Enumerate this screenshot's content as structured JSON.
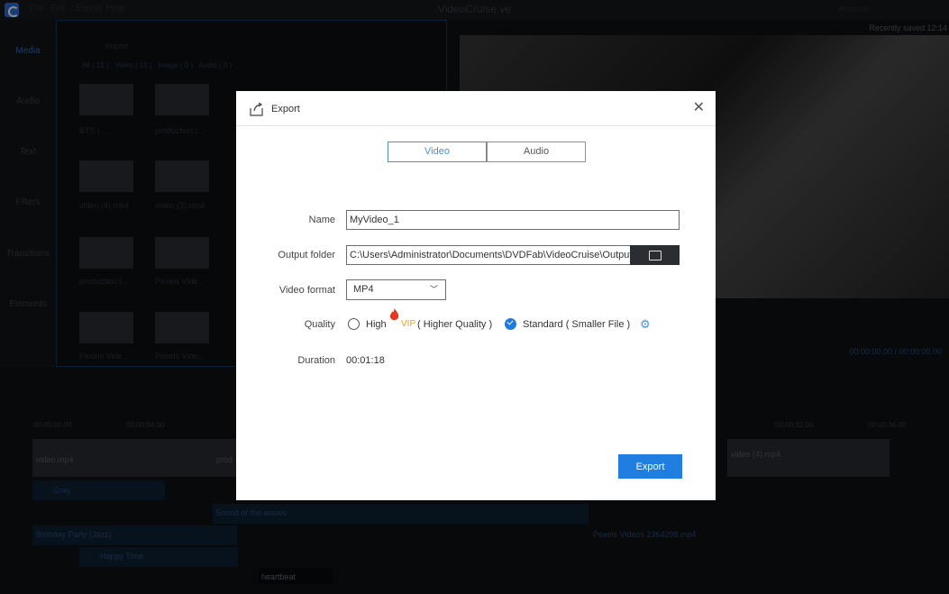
{
  "app": {
    "title": "VideoCruise.ve",
    "menus": [
      "File",
      "Edit",
      "Export",
      "Help"
    ],
    "account": "Account",
    "recently_saved": "Recently saved 12:14"
  },
  "sidebar": {
    "tabs": [
      "Media",
      "Audio",
      "Text",
      "Filters",
      "Transitions",
      "Elements"
    ]
  },
  "media": {
    "import_label": "Import",
    "filters": "All ( 15 )   Video ( 15 )   Image ( 0 )   Audio ( 0 )",
    "items": [
      "BTS ( ...",
      "production l...",
      "video (4).mp4",
      "video (3).mp4",
      "production l...",
      "Pexels Vide...",
      "Pexels Vide...",
      "Pexels Vide..."
    ]
  },
  "preview": {
    "timecode": "00:00:00.00  /  00:00:00.00"
  },
  "timeline": {
    "ruler": [
      "00:00:00.00",
      "00:00:04.00",
      "00:00:32.00",
      "00:00:36.00"
    ],
    "clips": {
      "video1": "video.mp4",
      "video2": "video (4).mp4",
      "prod": "prod",
      "filter": "Gray",
      "audio1": "Sound of the waves",
      "audio2": "Birthday Party (Jazz)",
      "audio3": "Pexels Videos 2364298.mp4",
      "text1": "Happy Time",
      "sticker": "heartbeat"
    }
  },
  "dialog": {
    "title": "Export",
    "close": "✕",
    "tabs": {
      "video": "Video",
      "audio": "Audio"
    },
    "labels": {
      "name": "Name",
      "output_folder": "Output folder",
      "video_format": "Video format",
      "quality": "Quality",
      "duration": "Duration"
    },
    "values": {
      "name": "MyVideo_1",
      "output_folder": "C:\\Users\\Administrator\\Documents\\DVDFab\\VideoCruise\\Output",
      "video_format": "MP4",
      "duration": "00:01:18"
    },
    "quality": {
      "high": "High",
      "vip": "VIP",
      "high_desc": "( Higher Quality )",
      "standard": "Standard ( Smaller File )",
      "selected": "standard"
    },
    "export_button": "Export"
  },
  "colors": {
    "accent": "#1f7ee0",
    "vip": "#f29b1e"
  }
}
